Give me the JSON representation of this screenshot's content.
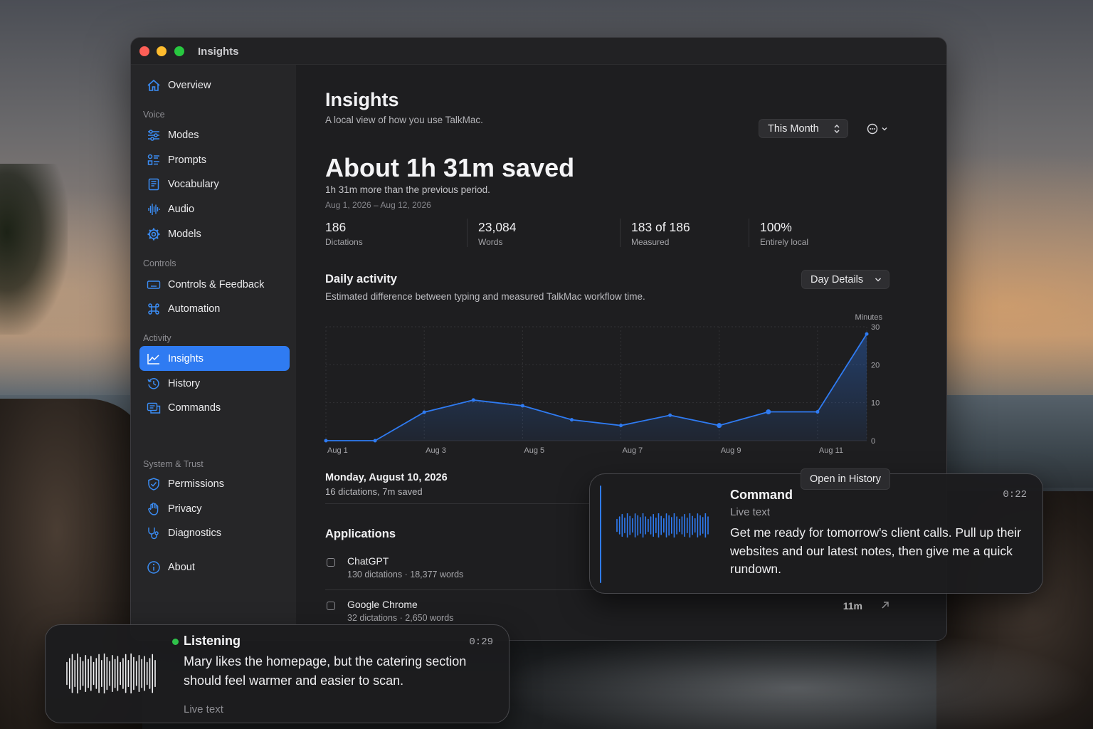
{
  "window": {
    "title": "Insights"
  },
  "sidebar": {
    "overview": "Overview",
    "sections": {
      "voice": "Voice",
      "controls": "Controls",
      "activity": "Activity",
      "system": "System & Trust"
    },
    "items": {
      "modes": "Modes",
      "prompts": "Prompts",
      "vocabulary": "Vocabulary",
      "audio": "Audio",
      "models": "Models",
      "controls_feedback": "Controls & Feedback",
      "automation": "Automation",
      "insights": "Insights",
      "history": "History",
      "commands": "Commands",
      "permissions": "Permissions",
      "privacy": "Privacy",
      "diagnostics": "Diagnostics",
      "about": "About"
    },
    "active_item": "insights",
    "accent_color": "#2f7bf2"
  },
  "header": {
    "title": "Insights",
    "subtitle": "A local view of how you use TalkMac.",
    "period": "This Month"
  },
  "summary": {
    "headline": "About 1h 31m saved",
    "comparison": "1h 31m more than the previous period.",
    "date_range": "Aug 1, 2026 – Aug 12, 2026",
    "stats": [
      {
        "value": "186",
        "label": "Dictations"
      },
      {
        "value": "23,084",
        "label": "Words"
      },
      {
        "value": "183 of 186",
        "label": "Measured"
      },
      {
        "value": "100%",
        "label": "Entirely local"
      }
    ]
  },
  "daily": {
    "title": "Daily activity",
    "subtitle": "Estimated difference between typing and measured TalkMac workflow time.",
    "view_select": "Day Details"
  },
  "chart_data": {
    "type": "area",
    "x": [
      "Aug 1",
      "Aug 2",
      "Aug 3",
      "Aug 4",
      "Aug 5",
      "Aug 6",
      "Aug 7",
      "Aug 8",
      "Aug 9",
      "Aug 10",
      "Aug 11",
      "Aug 12"
    ],
    "x_tick_labels": [
      "Aug 1",
      "Aug 3",
      "Aug 5",
      "Aug 7",
      "Aug 9",
      "Aug 11"
    ],
    "values": [
      0,
      0,
      7.5,
      10.7,
      9.2,
      5.5,
      4,
      6.7,
      4,
      7.6,
      7.6,
      28.1
    ],
    "ylabel": "Minutes",
    "ylim": [
      0,
      30
    ],
    "y_ticks": [
      0,
      10,
      20,
      30
    ],
    "grid": true,
    "highlighted_day": "Aug 10",
    "line_color": "#2f7bf2"
  },
  "day_detail": {
    "title": "Monday, August 10, 2026",
    "summary": "16 dictations, 7m saved",
    "open_history": "Open in History"
  },
  "applications": {
    "title": "Applications",
    "rows": [
      {
        "name": "ChatGPT",
        "meta": "130 dictations · 18,377 words",
        "time": ""
      },
      {
        "name": "Google Chrome",
        "meta": "32 dictations · 2,650 words",
        "time": "11m"
      }
    ]
  },
  "command_overlay": {
    "title": "Command",
    "subtitle": "Live text",
    "text": "Get me ready for tomorrow's client calls. Pull up their websites and our latest notes, then give me a quick rundown.",
    "time": "0:22"
  },
  "listening_overlay": {
    "title": "Listening",
    "text": "Mary  likes the homepage, but the catering section should feel warmer and easier to scan.",
    "footer": "Live text",
    "time": "0:29"
  }
}
